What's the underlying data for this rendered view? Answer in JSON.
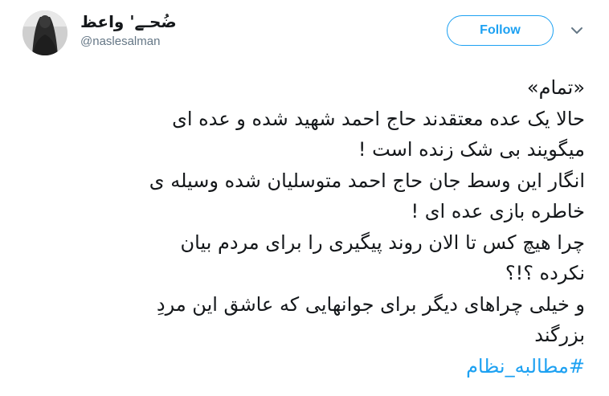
{
  "user": {
    "display_name": "ضُحـے' واعظ",
    "handle": "@naslesalman"
  },
  "header": {
    "follow_label": "Follow",
    "menu_icon": "chevron-down-icon"
  },
  "tweet": {
    "lines": [
      "«تمام»",
      "حالا یک عده معتقدند حاج احمد شهید شده و عده ای",
      "میگویند بی شک زنده است !",
      "انگار این وسط جان حاج احمد متوسلیان شده وسیله ی",
      "خاطره بازی عده ای !",
      "چرا هیچ کس تا الان روند پیگیری را برای مردم بیان",
      "نکرده ؟!؟",
      "و خیلی چراهای دیگر برای جوانهایی که عاشق این مردِ",
      "بزرگند"
    ],
    "hashtag": "#مطالبه_نظام"
  },
  "colors": {
    "accent": "#1da1f2",
    "text": "#14171a",
    "secondary": "#657786"
  }
}
